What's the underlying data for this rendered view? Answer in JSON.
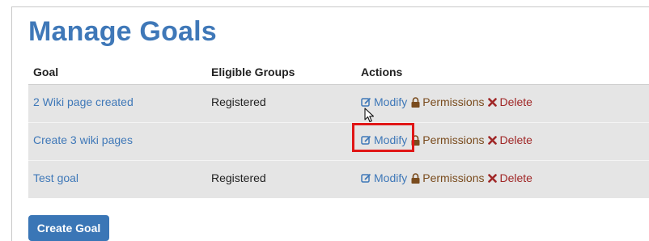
{
  "page": {
    "title": "Manage Goals"
  },
  "table": {
    "headers": {
      "goal": "Goal",
      "groups": "Eligible Groups",
      "actions": "Actions"
    },
    "rows": [
      {
        "goal": "2 Wiki page created",
        "groups": "Registered",
        "modify": "Modify",
        "permissions": "Permissions",
        "delete": "Delete"
      },
      {
        "goal": "Create 3 wiki pages",
        "groups": "",
        "modify": "Modify",
        "permissions": "Permissions",
        "delete": "Delete"
      },
      {
        "goal": "Test goal",
        "groups": "Registered",
        "modify": "Modify",
        "permissions": "Permissions",
        "delete": "Delete"
      }
    ]
  },
  "buttons": {
    "create_goal": "Create Goal"
  },
  "icons": {
    "modify": "edit-icon",
    "permissions": "lock-icon",
    "delete": "delete-x-icon",
    "cursor": "mouse-pointer-icon"
  },
  "colors": {
    "title": "#3f78b8",
    "link": "#3f78b8",
    "permissions": "#7a4c1e",
    "delete": "#a02727",
    "highlight": "#e01616",
    "button": "#3a76b6"
  }
}
